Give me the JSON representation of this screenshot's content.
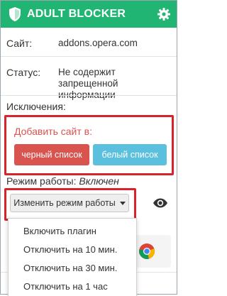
{
  "header": {
    "title": "ADULT BLOCKER",
    "shield_icon": "shield-icon",
    "settings_icon": "gear-icon"
  },
  "site": {
    "label": "Сайт:",
    "value": "addons.opera.com"
  },
  "status": {
    "label": "Статус:",
    "value": "Не содержит запрещенной информации"
  },
  "exclusions": {
    "label": "Исключения:",
    "add_label": "Добавить сайт в:",
    "black_list_button": "черный список",
    "white_list_button": "белый список"
  },
  "mode": {
    "label": "Режим работы:",
    "value": "Включен",
    "change_button": "Изменить режим работы",
    "eye_icon": "eye-icon"
  },
  "menu": {
    "items": [
      "Включить плагин",
      "Отключить на 10 мин.",
      "Отключить на 30 мин.",
      "Отключить на 1 час"
    ]
  },
  "colors": {
    "header": "#20b572",
    "highlight": "#d8232a",
    "black_list": "#d9534f",
    "white_list": "#5bc0de"
  }
}
